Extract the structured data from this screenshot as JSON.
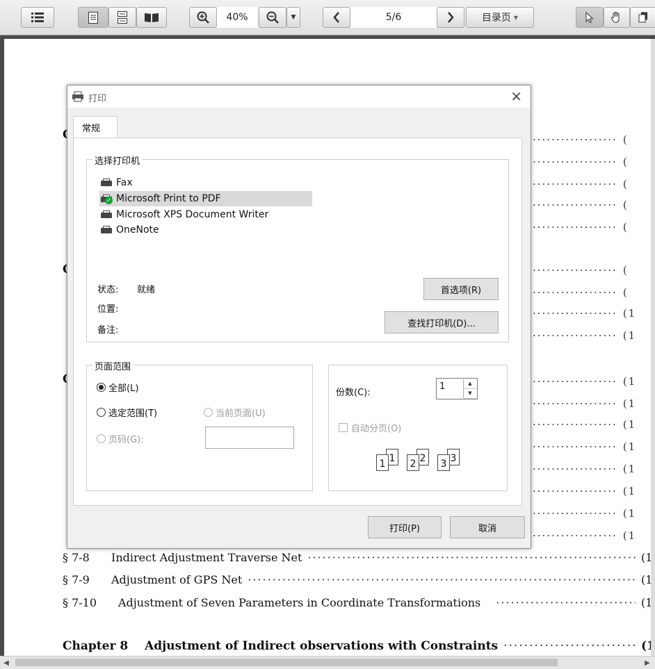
{
  "toolbar": {
    "zoom": "40%",
    "page_indicator": "5/6",
    "toc_button": "目录页"
  },
  "toc": {
    "lines": [
      {
        "section": "§ 7-8",
        "title": "Indirect Adjustment Traverse Net",
        "page": "(1"
      },
      {
        "section": "§ 7-9",
        "title": "Adjustment of GPS Net",
        "page": "(1"
      },
      {
        "section": "§ 7-10",
        "title": "Adjustment of Seven Parameters in Coordinate Transformations",
        "page": "(1"
      }
    ],
    "chapter": {
      "label": "Chapter 8",
      "title": "Adjustment of Indirect observations with Constraints",
      "page": "(1"
    },
    "chapter_initials": [
      "C",
      "C",
      "C"
    ],
    "partial_pages": [
      "(",
      "(",
      "(",
      "(",
      "(",
      "(",
      "(",
      "(1",
      "(1",
      "(1",
      "(1",
      "(1",
      "(1",
      "(1",
      "(1",
      "(1",
      "(1",
      "(1"
    ]
  },
  "dialog": {
    "title": "打印",
    "tab": "常规",
    "printer_group": "选择打印机",
    "printers": [
      "Fax",
      "Microsoft Print to PDF",
      "Microsoft XPS Document Writer",
      "OneNote"
    ],
    "status_label": "状态:",
    "status_value": "就绪",
    "location_label": "位置:",
    "comment_label": "备注:",
    "preferences_button": "首选项(R)",
    "find_printer_button": "查找打印机(D)...",
    "page_range_group": "页面范围",
    "range_all": "全部(L)",
    "range_selection": "选定范围(T)",
    "range_current": "当前页面(U)",
    "range_pages": "页码(G):",
    "copies_label": "份数(C):",
    "copies_value": "1",
    "collate_label": "自动分页(O)",
    "collate_numbers": [
      "1",
      "1",
      "2",
      "2",
      "3",
      "3"
    ],
    "print_button": "打印(P)",
    "cancel_button": "取消"
  }
}
